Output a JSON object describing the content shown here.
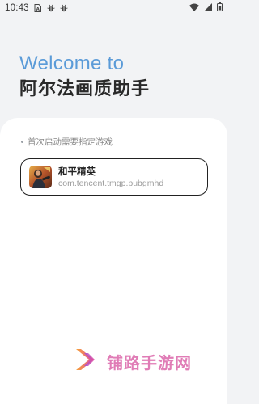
{
  "status_bar": {
    "time": "10:43",
    "icons_left": [
      "sim-card-icon",
      "bug-icon",
      "bug-icon"
    ],
    "icons_right": [
      "wifi-icon",
      "signal-icon",
      "battery-icon"
    ]
  },
  "welcome": {
    "line1": "Welcome to",
    "line2": "阿尔法画质助手",
    "accent_color": "#5b9bd8"
  },
  "main": {
    "hint": "首次启动需要指定游戏",
    "games": [
      {
        "name": "和平精英",
        "package": "com.tencent.tmgp.pubgmhd",
        "icon": "game-app-icon"
      }
    ]
  },
  "watermark": {
    "text": "铺路手游网",
    "logo": "double-chevron-logo"
  }
}
